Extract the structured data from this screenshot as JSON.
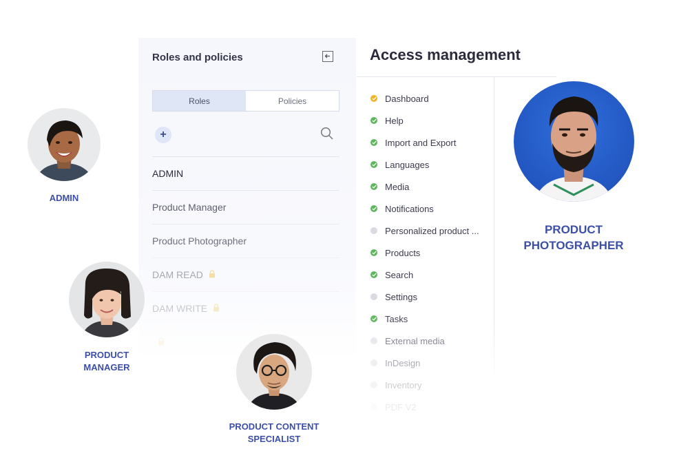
{
  "roles_panel": {
    "title": "Roles and policies",
    "tabs": [
      {
        "label": "Roles",
        "active": true
      },
      {
        "label": "Policies",
        "active": false
      }
    ],
    "add_label": "+",
    "roles": [
      {
        "name": "ADMIN",
        "locked": false,
        "opacity": 1.0
      },
      {
        "name": "Product Manager",
        "locked": false,
        "opacity": 0.95
      },
      {
        "name": "Product Photographer",
        "locked": false,
        "opacity": 0.85
      },
      {
        "name": "DAM READ",
        "locked": true,
        "opacity": 0.5
      },
      {
        "name": "DAM WRITE",
        "locked": true,
        "opacity": 0.3
      },
      {
        "name": "",
        "locked": true,
        "opacity": 0.12
      }
    ]
  },
  "access_panel": {
    "title": "Access management",
    "permissions": [
      {
        "label": "Dashboard",
        "status": "partial",
        "opacity": 1.0
      },
      {
        "label": "Help",
        "status": "full",
        "opacity": 1.0
      },
      {
        "label": "Import and Export",
        "status": "full",
        "opacity": 1.0
      },
      {
        "label": "Languages",
        "status": "full",
        "opacity": 1.0
      },
      {
        "label": "Media",
        "status": "full",
        "opacity": 1.0
      },
      {
        "label": "Notifications",
        "status": "full",
        "opacity": 1.0
      },
      {
        "label": "Personalized product ...",
        "status": "none",
        "opacity": 1.0
      },
      {
        "label": "Products",
        "status": "full",
        "opacity": 1.0
      },
      {
        "label": "Search",
        "status": "full",
        "opacity": 1.0
      },
      {
        "label": "Settings",
        "status": "none",
        "opacity": 1.0
      },
      {
        "label": "Tasks",
        "status": "full",
        "opacity": 0.95
      },
      {
        "label": "External media",
        "status": "none",
        "opacity": 0.6
      },
      {
        "label": "InDesign",
        "status": "none",
        "opacity": 0.42
      },
      {
        "label": "Inventory",
        "status": "none",
        "opacity": 0.25
      },
      {
        "label": "PDF V2",
        "status": "none",
        "opacity": 0.1
      }
    ]
  },
  "people": [
    {
      "key": "admin",
      "label_lines": [
        "ADMIN"
      ]
    },
    {
      "key": "product-manager",
      "label_lines": [
        "PRODUCT",
        "MANAGER"
      ]
    },
    {
      "key": "product-content-specialist",
      "label_lines": [
        "PRODUCT CONTENT",
        "SPECIALIST"
      ]
    },
    {
      "key": "product-photographer",
      "label_lines": [
        "PRODUCT",
        "PHOTOGRAPHER"
      ]
    }
  ],
  "colors": {
    "status_full": "#5cb85c",
    "status_partial": "#f0b429",
    "status_none": "#d9dbe3",
    "lock": "#f2c14e",
    "person_label": "#3b4ea8"
  }
}
